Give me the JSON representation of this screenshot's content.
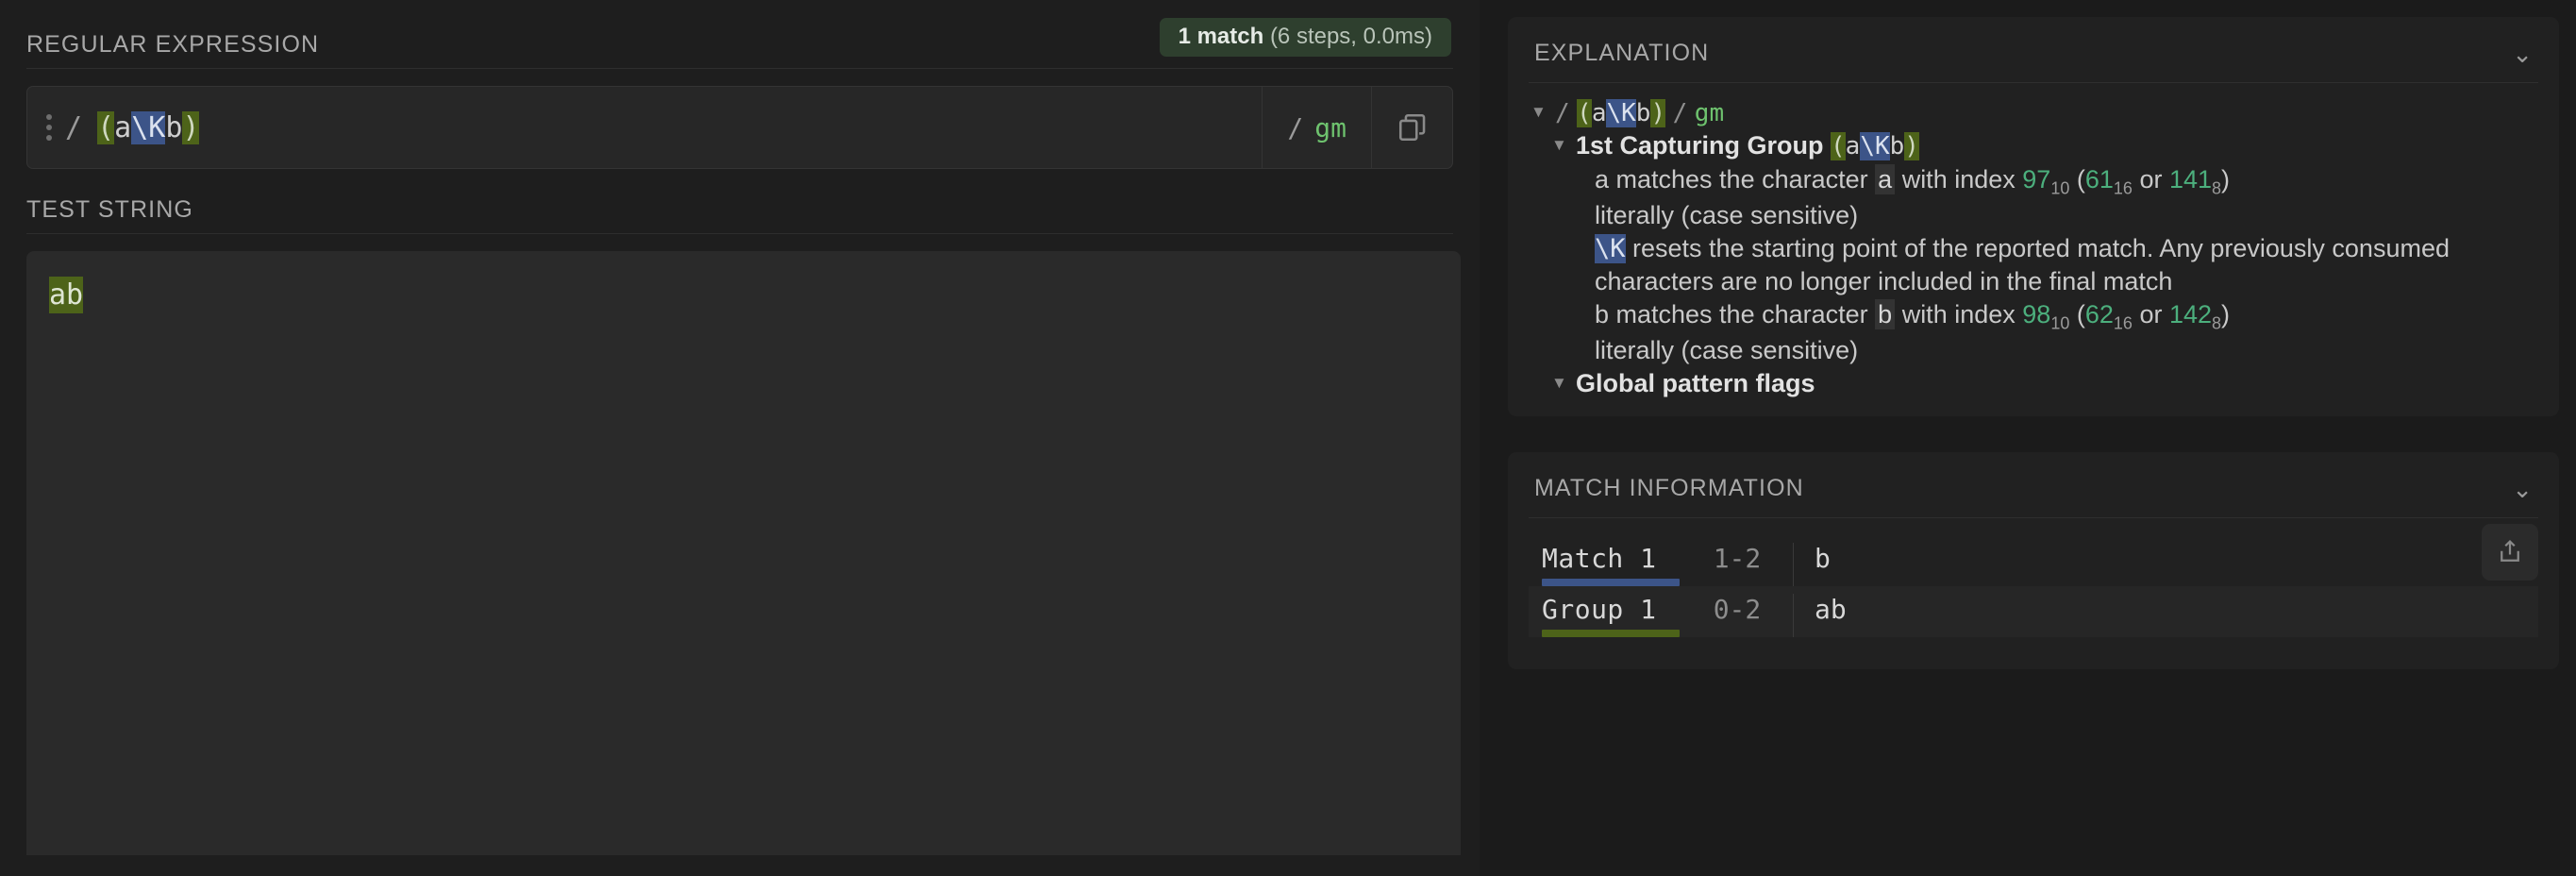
{
  "regex_panel": {
    "title": "REGULAR EXPRESSION",
    "match_badge": {
      "count_label": "1 match",
      "detail": "(6 steps, 0.0ms)"
    },
    "menu_icon": "kebab-menu-icon",
    "open_delimiter": "/",
    "pattern_tokens": [
      {
        "text": "(",
        "style": "green"
      },
      {
        "text": "a",
        "style": "plain"
      },
      {
        "text": "\\K",
        "style": "blue"
      },
      {
        "text": "b",
        "style": "plain"
      },
      {
        "text": ")",
        "style": "green"
      }
    ],
    "close_delimiter": "/",
    "flags": "gm",
    "copy_icon": "copy-icon"
  },
  "test_string_panel": {
    "title": "TEST STRING",
    "content": "ab",
    "highlight": "ab"
  },
  "explanation_panel": {
    "title": "EXPLANATION",
    "collapse_icon": "chevron-down-icon",
    "root": {
      "slash_open": "/",
      "slash_close": "/",
      "flags": "gm"
    },
    "group_label": "1st Capturing Group",
    "lines": {
      "a_match": {
        "prefix": "a matches the character ",
        "char": "a",
        "mid": " with index ",
        "dec": "97",
        "dec_sub": "10",
        "paren_open": "(",
        "hex": "61",
        "hex_sub": "16",
        "or": " or ",
        "oct": "141",
        "oct_sub": "8",
        "paren_close": ")"
      },
      "a_literally": "literally (case sensitive)",
      "k_token": "\\K",
      "k_desc": " resets the starting point of the reported match. Any previously consumed characters are no longer included in the final match",
      "b_match": {
        "prefix": "b matches the character ",
        "char": "b",
        "mid": " with index ",
        "dec": "98",
        "dec_sub": "10",
        "paren_open": "(",
        "hex": "62",
        "hex_sub": "16",
        "or": " or ",
        "oct": "142",
        "oct_sub": "8",
        "paren_close": ")"
      },
      "b_literally": "literally (case sensitive)",
      "global_flags": "Global pattern flags"
    }
  },
  "match_information_panel": {
    "title": "MATCH INFORMATION",
    "collapse_icon": "chevron-down-icon",
    "export_icon": "export-share-icon",
    "rows": [
      {
        "label": "Match 1",
        "range": "1-2",
        "value": "b",
        "bar_color": "#3c5488"
      },
      {
        "label": "Group 1",
        "range": "0-2",
        "value": "ab",
        "bar_color": "#4d6319"
      }
    ]
  },
  "colors": {
    "accent_green": "#4d6319",
    "accent_blue": "#3c5488",
    "flag_green": "#6ec26e",
    "number_green": "#4caf7d",
    "badge_bg": "#2e3f2e"
  }
}
